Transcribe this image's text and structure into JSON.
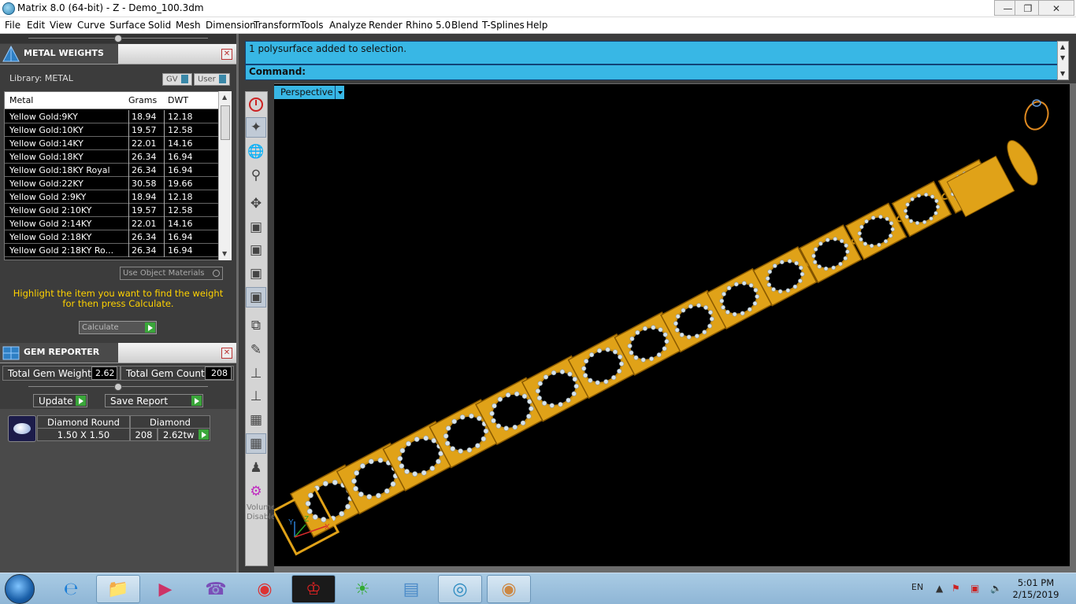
{
  "window": {
    "title": "Matrix 8.0 (64-bit) - Z - Demo_100.3dm"
  },
  "menu": [
    "File",
    "Edit",
    "View",
    "Curve",
    "Surface",
    "Solid",
    "Mesh",
    "Dimension",
    "Transform",
    "Tools",
    "Analyze",
    "Render",
    "Rhino 5.0",
    "Blend",
    "T-Splines",
    "Help"
  ],
  "metal_weights": {
    "title": "METAL WEIGHTS",
    "library_label": "Library: METAL",
    "gv_label": "GV",
    "user_label": "User",
    "columns": [
      "Metal",
      "Grams",
      "DWT"
    ],
    "rows": [
      [
        "Yellow Gold:9KY",
        "18.94",
        "12.18"
      ],
      [
        "Yellow Gold:10KY",
        "19.57",
        "12.58"
      ],
      [
        "Yellow Gold:14KY",
        "22.01",
        "14.16"
      ],
      [
        "Yellow Gold:18KY",
        "26.34",
        "16.94"
      ],
      [
        "Yellow Gold:18KY Royal",
        "26.34",
        "16.94"
      ],
      [
        "Yellow Gold:22KY",
        "30.58",
        "19.66"
      ],
      [
        "Yellow Gold 2:9KY",
        "18.94",
        "12.18"
      ],
      [
        "Yellow Gold 2:10KY",
        "19.57",
        "12.58"
      ],
      [
        "Yellow Gold 2:14KY",
        "22.01",
        "14.16"
      ],
      [
        "Yellow Gold 2:18KY",
        "26.34",
        "16.94"
      ],
      [
        "Yellow Gold 2:18KY Ro...",
        "26.34",
        "16.94"
      ]
    ],
    "use_object_materials": "Use Object Materials",
    "hint": "Highlight the item you want to find the weight for then press Calculate.",
    "calculate_label": "Calculate"
  },
  "gem_reporter": {
    "title": "GEM REPORTER",
    "total_weight_label": "Total Gem Weight",
    "total_weight_value": "2.62",
    "total_count_label": "Total Gem Count",
    "total_count_value": "208",
    "update_label": "Update",
    "save_report_label": "Save Report",
    "gem": {
      "shape": "Diamond Round",
      "size": "1.50 X 1.50",
      "material": "Diamond",
      "count": "208",
      "weight": "2.62tw"
    }
  },
  "command": {
    "history": "1 polysurface added to selection.",
    "prompt": "Command:"
  },
  "viewport": {
    "label": "Perspective",
    "axis_labels": [
      "Y",
      "Z",
      "X"
    ]
  },
  "toolbar": {
    "status_text": "Volume Disabled",
    "tools": [
      "power-icon",
      "plane-icon",
      "globe-icon",
      "molecule-icon",
      "axes-icon",
      "cube-front-icon",
      "cube-top-icon",
      "cube-right-icon",
      "cube-perspective-icon",
      "resize-icon",
      "brush-icon",
      "snap-off-icon",
      "snap-r-icon",
      "layers-icon",
      "gumball-icon",
      "walk-icon",
      "gear-icon"
    ]
  },
  "taskbar": {
    "apps": [
      "ie-icon",
      "explorer-icon",
      "media-icon",
      "viber-icon",
      "chrome-icon",
      "app-red-icon",
      "app-green-icon",
      "notepad-icon",
      "matrix-icon",
      "paint-icon"
    ],
    "language": "EN",
    "time": "5:01 PM",
    "date": "2/15/2019"
  },
  "colors": {
    "accent": "#38b7e5",
    "gold": "#e0a218",
    "hint": "#ffd200"
  }
}
